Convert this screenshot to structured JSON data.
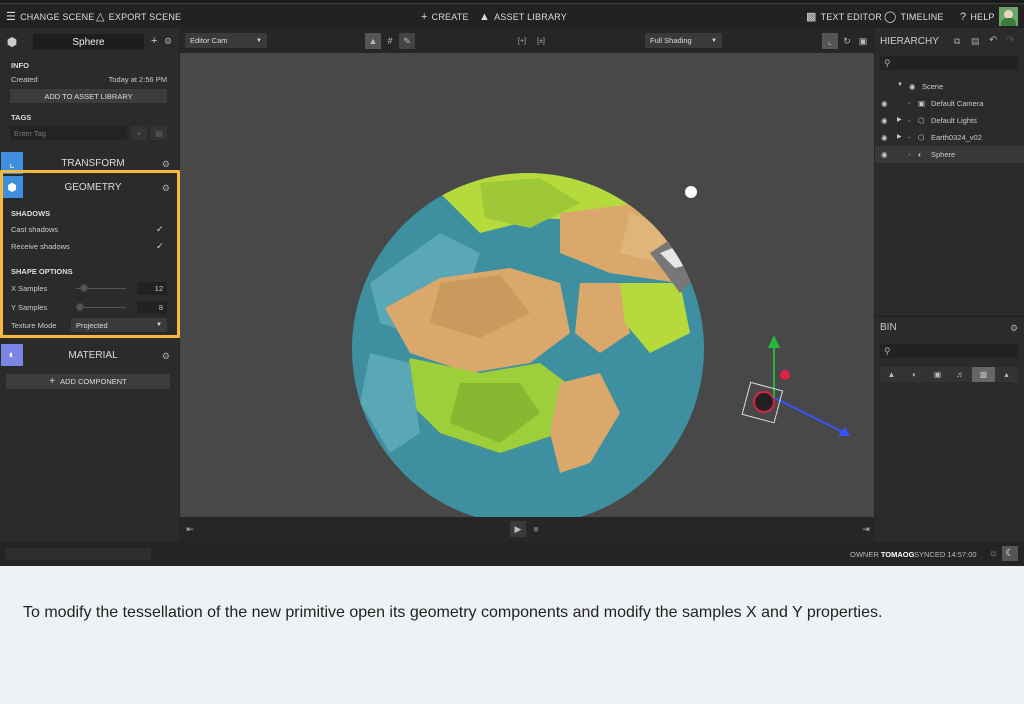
{
  "menubar": {
    "change_scene": "CHANGE SCENE",
    "export_scene": "EXPORT SCENE",
    "create": "CREATE",
    "asset_library": "ASSET LIBRARY",
    "text_editor": "TEXT EDITOR",
    "timeline": "TIMELINE",
    "help": "HELP"
  },
  "entity": {
    "name": "Sphere"
  },
  "info": {
    "section": "INFO",
    "created_label": "Created",
    "created_value": "Today at 2:56 PM",
    "add_to_library": "ADD TO ASSET LIBRARY"
  },
  "tags": {
    "section": "TAGS",
    "placeholder": "Enter Tag"
  },
  "components": {
    "transform": "TRANSFORM",
    "geometry": "GEOMETRY",
    "material": "MATERIAL",
    "add_component": "ADD COMPONENT"
  },
  "geometry": {
    "shadows_section": "SHADOWS",
    "cast_shadows": "Cast shadows",
    "receive_shadows": "Receive shadows",
    "shape_section": "SHAPE OPTIONS",
    "x_samples_label": "X Samples",
    "x_samples_value": "12",
    "y_samples_label": "Y Samples",
    "y_samples_value": "8",
    "texture_mode_label": "Texture Mode",
    "texture_mode_value": "Projected"
  },
  "viewport": {
    "camera": "Editor Cam",
    "shading": "Full Shading",
    "bracket_left": "[+]",
    "bracket_right": "[±]"
  },
  "hierarchy": {
    "title": "HIERARCHY",
    "items": [
      {
        "label": "Scene"
      },
      {
        "label": "Default Camera"
      },
      {
        "label": "Default Lights"
      },
      {
        "label": "Earth0324_v02"
      },
      {
        "label": "Sphere"
      }
    ]
  },
  "bin": {
    "title": "BIN"
  },
  "status": {
    "owner_label": "OWNER",
    "owner_value": "TOMAOG",
    "synced": "SYNCED 14:57:00"
  },
  "caption": "To modify the tessellation of the new primitive open its geometry components and modify the samples X and Y properties.",
  "colors": {
    "highlight": "#f8b93c",
    "tab_blue": "#3f8fdc",
    "material_tab": "#7a85e6"
  }
}
